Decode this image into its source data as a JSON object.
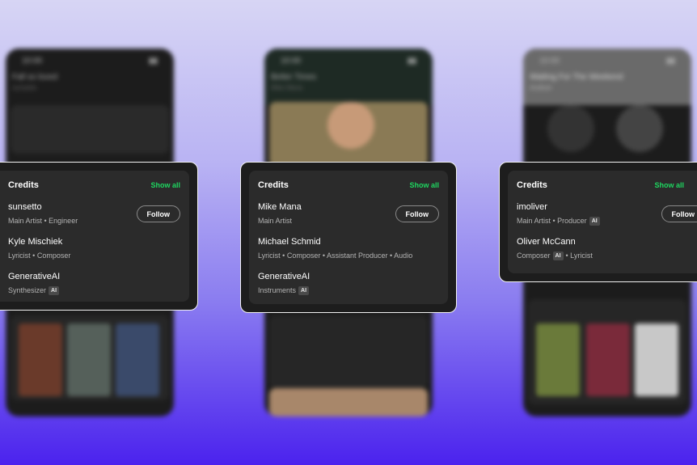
{
  "cards": [
    {
      "title": "Credits",
      "show_all": "Show all",
      "follow": "Follow",
      "credits": [
        {
          "name": "sunsetto",
          "roles": "Main Artist • Engineer"
        },
        {
          "name": "Kyle Mischiek",
          "roles": "Lyricist • Composer"
        },
        {
          "name": "GenerativeAI",
          "roles": "Synthesizer",
          "badge": "AI"
        }
      ]
    },
    {
      "title": "Credits",
      "show_all": "Show all",
      "follow": "Follow",
      "credits": [
        {
          "name": "Mike Mana",
          "roles": "Main Artist"
        },
        {
          "name": "Michael Schmid",
          "roles": "Lyricist • Composer • Assistant Producer • Audio"
        },
        {
          "name": "GenerativeAI",
          "roles": "Instruments",
          "badge": "AI"
        }
      ]
    },
    {
      "title": "Credits",
      "show_all": "Show all",
      "follow": "Follow",
      "credits": [
        {
          "name": "imoliver",
          "roles": "Main Artist • Producer",
          "badge": "AI"
        },
        {
          "name": "Oliver McCann",
          "roles": "Composer",
          "badge": "AI",
          "roles_after": "• Lyricist"
        }
      ]
    }
  ],
  "colors": {
    "accent_green": "#1ed760",
    "card_bg": "#2b2b2b",
    "background_top": "#d7d5f4",
    "background_bottom": "#4b22ee"
  }
}
